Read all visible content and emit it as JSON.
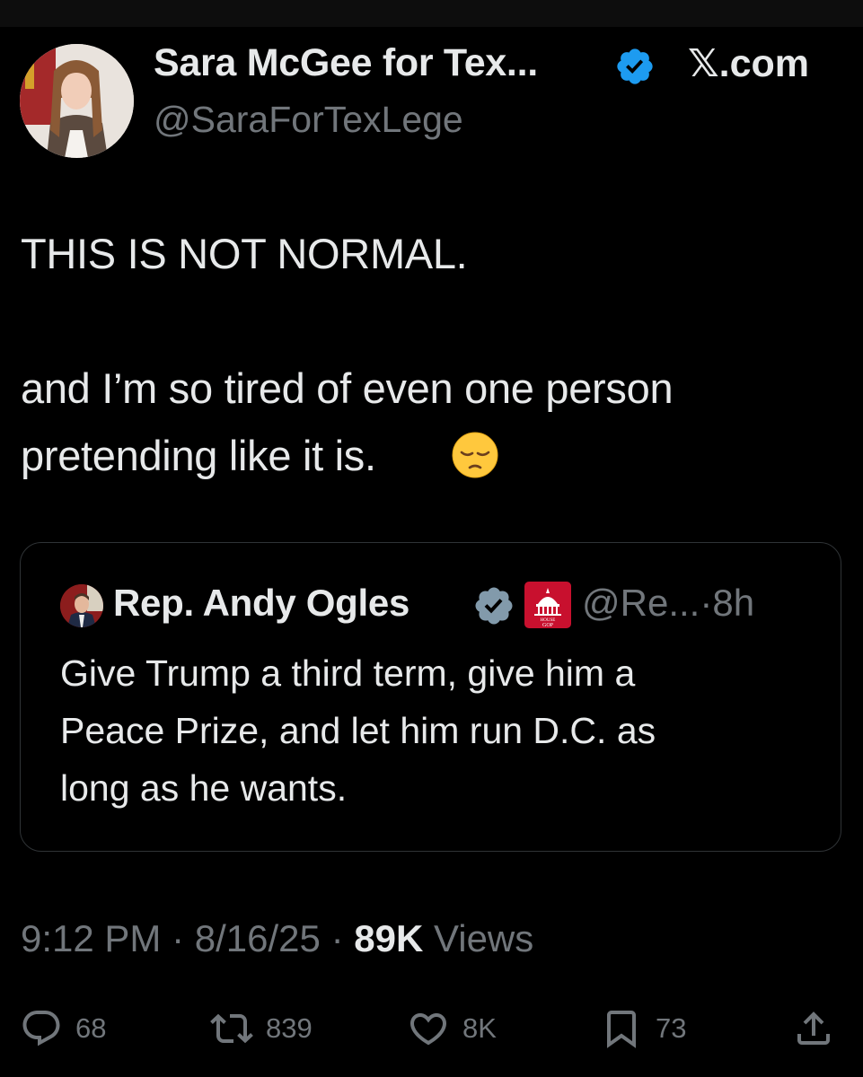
{
  "author": {
    "display_name": "Sara McGee for Tex...",
    "handle": "@SaraForTexLege",
    "verified": true
  },
  "site": "𝕏.com",
  "tweet": {
    "lines": [
      "THIS IS NOT NORMAL.",
      "and I’m so tired of even one person",
      "pretending like it is."
    ],
    "emoji": "pensive-face"
  },
  "quote": {
    "name": "Rep. Andy Ogles",
    "verified": true,
    "affiliation_badge": "HOUSE GOP",
    "handle": "@Re...",
    "separator": "·",
    "time": "8h",
    "lines": [
      "Give Trump a third term, give him a",
      "Peace Prize, and let him run D.C. as",
      "long as he wants."
    ]
  },
  "meta": {
    "time": "9:12 PM",
    "date": "8/16/25",
    "separator": "·",
    "views_count": "89K",
    "views_label": "Views"
  },
  "actions": {
    "replies": "68",
    "reposts": "839",
    "likes": "8K",
    "bookmarks": "73"
  },
  "colors": {
    "background": "#000000",
    "text_primary": "#e7e9ea",
    "text_secondary": "#71767b",
    "verified_blue": "#1d9bf0",
    "border": "#2f3336",
    "gop_red": "#c8102e"
  }
}
